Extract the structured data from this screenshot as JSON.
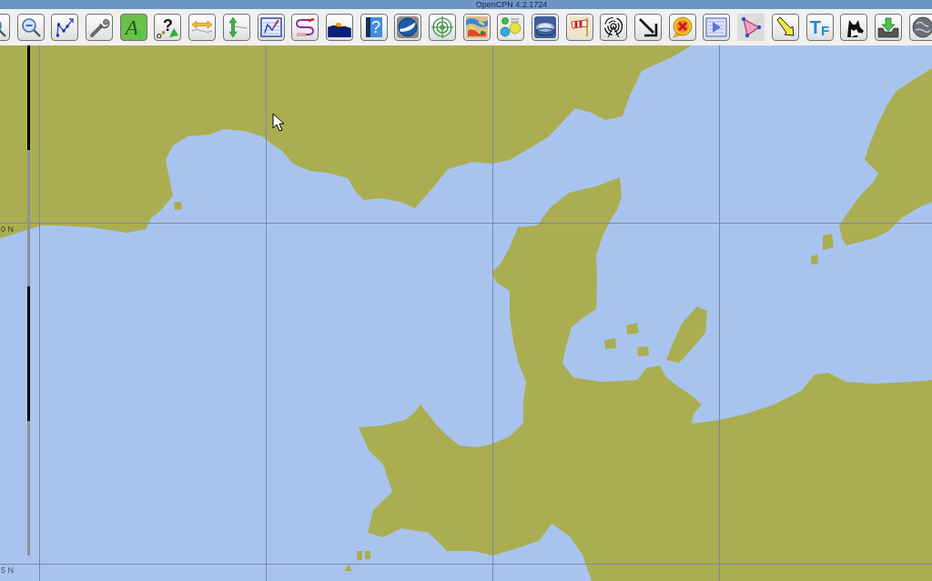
{
  "window": {
    "title": "OpenCPN 4.2.1724"
  },
  "toolbar": {
    "buttons": [
      {
        "kind": "zoomin",
        "toggled": false
      },
      {
        "kind": "zoomout",
        "toggled": false
      },
      {
        "kind": "route",
        "toggled": false
      },
      {
        "kind": "settings",
        "toggled": false
      },
      {
        "kind": "annotate",
        "glyph": "A",
        "toggled": false
      },
      {
        "kind": "query",
        "glyph": "?",
        "toggled": false
      },
      {
        "kind": "span",
        "toggled": false
      },
      {
        "kind": "depth",
        "toggled": false
      },
      {
        "kind": "routes",
        "toggled": false
      },
      {
        "kind": "track",
        "toggled": false
      },
      {
        "kind": "tides",
        "toggled": false
      },
      {
        "kind": "help",
        "glyph": "?",
        "toggled": false
      },
      {
        "kind": "earth",
        "toggled": false
      },
      {
        "kind": "target",
        "toggled": false
      },
      {
        "kind": "weather",
        "toggled": false
      },
      {
        "kind": "dashboard",
        "toggled": false
      },
      {
        "kind": "disk",
        "toggled": false
      },
      {
        "kind": "wind",
        "toggled": false
      },
      {
        "kind": "radar",
        "toggled": false
      },
      {
        "kind": "arrow",
        "toggled": false
      },
      {
        "kind": "alert",
        "toggled": false
      },
      {
        "kind": "player",
        "toggled": false
      },
      {
        "kind": "polygon",
        "toggled": true
      },
      {
        "kind": "pointer",
        "toggled": false
      },
      {
        "kind": "font",
        "glyph": "T$_{F}$",
        "toggled": false
      },
      {
        "kind": "dog",
        "toggled": false
      },
      {
        "kind": "download",
        "toggled": false
      },
      {
        "kind": "globe",
        "toggled": false
      }
    ]
  },
  "chart": {
    "latitude_labels": [
      "0 N",
      "5 N"
    ]
  }
}
